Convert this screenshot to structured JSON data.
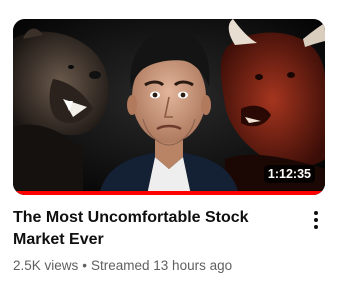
{
  "video": {
    "title": "The Most Uncomfortable Stock Market Ever",
    "duration": "1:12:35",
    "views": "2.5K views",
    "separator": "•",
    "streamed": "Streamed 13 hours ago",
    "progress_fraction": 1.0,
    "thumbnail_icons": [
      "bear-image",
      "man-portrait",
      "bull-image"
    ]
  },
  "menu": {
    "icon": "more-vert-icon"
  },
  "colors": {
    "progress": "#ff0000",
    "title": "#0f0f0f",
    "meta": "#606060"
  }
}
